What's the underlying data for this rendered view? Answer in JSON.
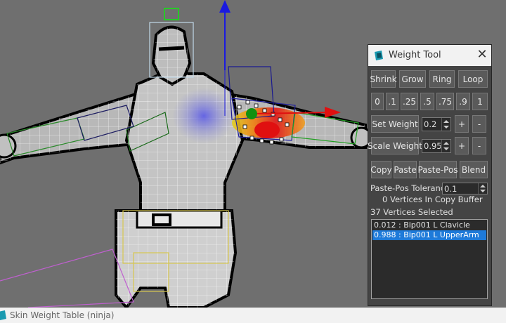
{
  "weight_tool": {
    "title": "Weight Tool",
    "close_glyph": "✕",
    "shrink_label": "Shrink",
    "grow_label": "Grow",
    "ring_label": "Ring",
    "loop_label": "Loop",
    "presets": [
      "0",
      ".1",
      ".25",
      ".5",
      ".75",
      ".9",
      "1"
    ],
    "set_weight_label": "Set Weight",
    "set_weight_value": "0.2",
    "scale_weight_label": "Scale Weight",
    "scale_weight_value": "0.95",
    "plus_glyph": "+",
    "minus_glyph": "-",
    "copy_label": "Copy",
    "paste_label": "Paste",
    "paste_pos_label": "Paste-Pos",
    "blend_label": "Blend",
    "tolerance_label": "Paste-Pos Tolerance",
    "tolerance_value": "0.1",
    "copy_buffer_text": "0 Vertices In Copy Buffer",
    "vertices_selected_text": "37 Vertices Selected",
    "bones": [
      {
        "text": "0.012 : Bip001 L Clavicle",
        "selected": false
      },
      {
        "text": "0.988 : Bip001 L UpperArm",
        "selected": true
      }
    ]
  },
  "bottom_window": {
    "title": "Skin Weight Table (ninja)"
  },
  "icons": {
    "app_logo": "3dsmax-logo-icon",
    "close": "close-icon"
  },
  "colors": {
    "selection": "#1e7ad9",
    "gizmo_x": "#e01010",
    "gizmo_y": "#28c828",
    "gizmo_z": "#1a1ae0"
  }
}
